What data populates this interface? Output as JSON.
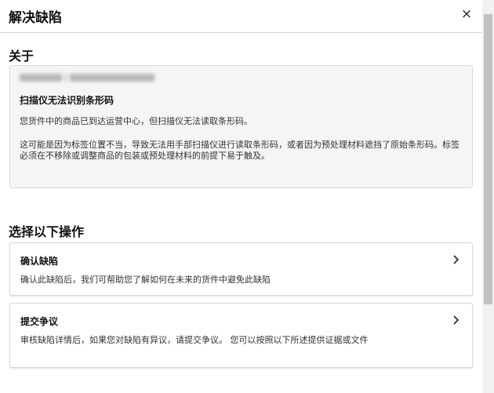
{
  "header": {
    "title": "解决缺陷",
    "close_icon": "×"
  },
  "about": {
    "section_title": "关于",
    "defect_title": "扫描仪无法识别条形码",
    "paragraph1": "您货件中的商品已到达运营中心，但扫描仪无法读取条形码。",
    "paragraph2": "这可能是因为标签位置不当，导致无法用手部扫描仪进行读取条形码，或者因为预处理材料遮挡了原始条形码。标签必须在不移除或调整商品的包装或预处理材料的前提下易于触及。"
  },
  "actions": {
    "section_title": "选择以下操作",
    "options": [
      {
        "title": "确认缺陷",
        "description": "确认此缺陷后，我们可帮助您了解如何在未来的货件中避免此缺陷"
      },
      {
        "title": "提交争议",
        "description": "审核缺陷详情后，如果您对缺陷有异议，请提交争议。 您可以按照以下所述提供证据或文件"
      }
    ]
  }
}
